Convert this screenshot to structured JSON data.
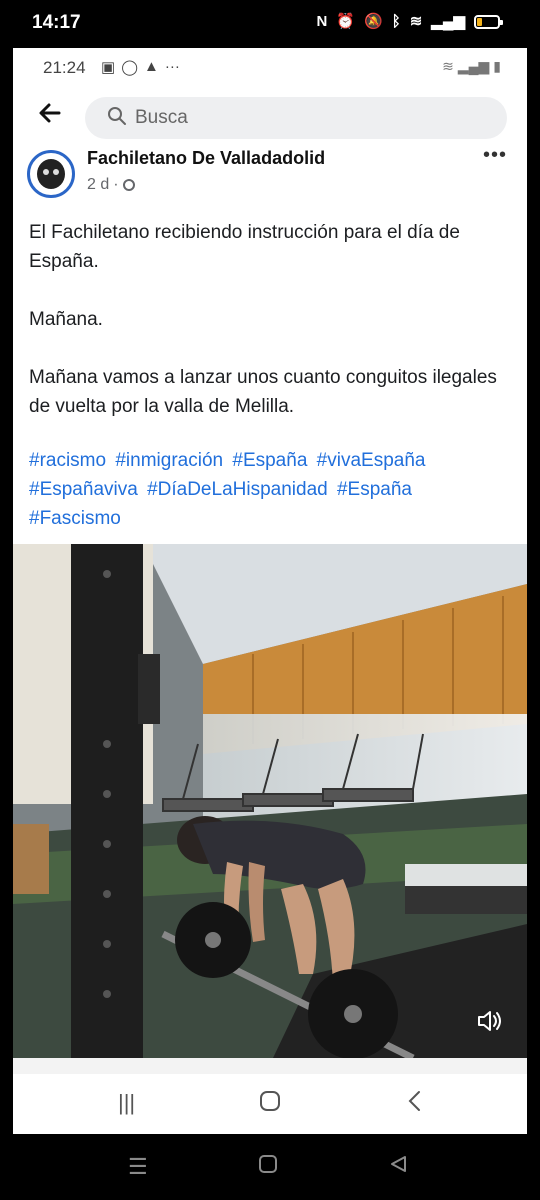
{
  "outer_status": {
    "time": "14:17",
    "nfc": "N",
    "battery_color": "#f2b21b"
  },
  "inner_status": {
    "time": "21:24"
  },
  "search": {
    "placeholder": "Busca"
  },
  "post": {
    "author": "Fachiletano De Valladadolid",
    "age": "2 d",
    "paragraphs": [
      "El Fachiletano recibiendo instrucción para el día de España.",
      "Mañana.",
      "Mañana vamos a lanzar unos cuanto conguitos ilegales de vuelta por la valla de Melilla."
    ],
    "hashtags": [
      "#racismo",
      "#inmigración",
      "#España",
      "#vivaEspaña",
      "#Españaviva",
      "#DíaDeLaHispanidad",
      "#España",
      "#Fascismo"
    ],
    "hashtag_color": "#216fdb"
  },
  "video": {
    "icon": "speaker-muted-icon"
  },
  "icons": {
    "back": "arrow-left-icon",
    "search": "search-icon",
    "more": "more-dots-icon",
    "privacy": "globe-icon"
  }
}
